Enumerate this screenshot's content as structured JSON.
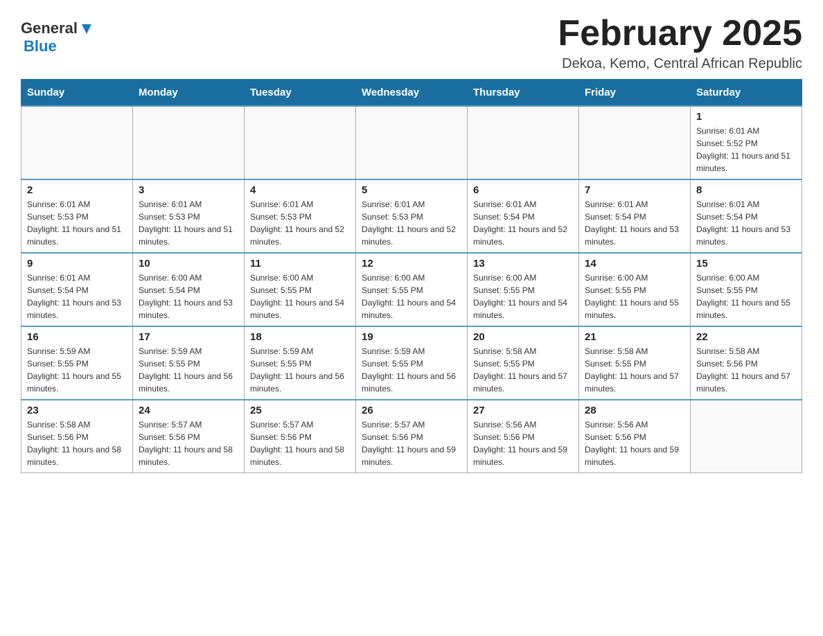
{
  "header": {
    "logo": {
      "general": "General",
      "blue": "Blue"
    },
    "title": "February 2025",
    "subtitle": "Dekoa, Kemo, Central African Republic"
  },
  "calendar": {
    "days_of_week": [
      "Sunday",
      "Monday",
      "Tuesday",
      "Wednesday",
      "Thursday",
      "Friday",
      "Saturday"
    ],
    "weeks": [
      [
        {
          "day": "",
          "info": ""
        },
        {
          "day": "",
          "info": ""
        },
        {
          "day": "",
          "info": ""
        },
        {
          "day": "",
          "info": ""
        },
        {
          "day": "",
          "info": ""
        },
        {
          "day": "",
          "info": ""
        },
        {
          "day": "1",
          "info": "Sunrise: 6:01 AM\nSunset: 5:52 PM\nDaylight: 11 hours and 51 minutes."
        }
      ],
      [
        {
          "day": "2",
          "info": "Sunrise: 6:01 AM\nSunset: 5:53 PM\nDaylight: 11 hours and 51 minutes."
        },
        {
          "day": "3",
          "info": "Sunrise: 6:01 AM\nSunset: 5:53 PM\nDaylight: 11 hours and 51 minutes."
        },
        {
          "day": "4",
          "info": "Sunrise: 6:01 AM\nSunset: 5:53 PM\nDaylight: 11 hours and 52 minutes."
        },
        {
          "day": "5",
          "info": "Sunrise: 6:01 AM\nSunset: 5:53 PM\nDaylight: 11 hours and 52 minutes."
        },
        {
          "day": "6",
          "info": "Sunrise: 6:01 AM\nSunset: 5:54 PM\nDaylight: 11 hours and 52 minutes."
        },
        {
          "day": "7",
          "info": "Sunrise: 6:01 AM\nSunset: 5:54 PM\nDaylight: 11 hours and 53 minutes."
        },
        {
          "day": "8",
          "info": "Sunrise: 6:01 AM\nSunset: 5:54 PM\nDaylight: 11 hours and 53 minutes."
        }
      ],
      [
        {
          "day": "9",
          "info": "Sunrise: 6:01 AM\nSunset: 5:54 PM\nDaylight: 11 hours and 53 minutes."
        },
        {
          "day": "10",
          "info": "Sunrise: 6:00 AM\nSunset: 5:54 PM\nDaylight: 11 hours and 53 minutes."
        },
        {
          "day": "11",
          "info": "Sunrise: 6:00 AM\nSunset: 5:55 PM\nDaylight: 11 hours and 54 minutes."
        },
        {
          "day": "12",
          "info": "Sunrise: 6:00 AM\nSunset: 5:55 PM\nDaylight: 11 hours and 54 minutes."
        },
        {
          "day": "13",
          "info": "Sunrise: 6:00 AM\nSunset: 5:55 PM\nDaylight: 11 hours and 54 minutes."
        },
        {
          "day": "14",
          "info": "Sunrise: 6:00 AM\nSunset: 5:55 PM\nDaylight: 11 hours and 55 minutes."
        },
        {
          "day": "15",
          "info": "Sunrise: 6:00 AM\nSunset: 5:55 PM\nDaylight: 11 hours and 55 minutes."
        }
      ],
      [
        {
          "day": "16",
          "info": "Sunrise: 5:59 AM\nSunset: 5:55 PM\nDaylight: 11 hours and 55 minutes."
        },
        {
          "day": "17",
          "info": "Sunrise: 5:59 AM\nSunset: 5:55 PM\nDaylight: 11 hours and 56 minutes."
        },
        {
          "day": "18",
          "info": "Sunrise: 5:59 AM\nSunset: 5:55 PM\nDaylight: 11 hours and 56 minutes."
        },
        {
          "day": "19",
          "info": "Sunrise: 5:59 AM\nSunset: 5:55 PM\nDaylight: 11 hours and 56 minutes."
        },
        {
          "day": "20",
          "info": "Sunrise: 5:58 AM\nSunset: 5:55 PM\nDaylight: 11 hours and 57 minutes."
        },
        {
          "day": "21",
          "info": "Sunrise: 5:58 AM\nSunset: 5:55 PM\nDaylight: 11 hours and 57 minutes."
        },
        {
          "day": "22",
          "info": "Sunrise: 5:58 AM\nSunset: 5:56 PM\nDaylight: 11 hours and 57 minutes."
        }
      ],
      [
        {
          "day": "23",
          "info": "Sunrise: 5:58 AM\nSunset: 5:56 PM\nDaylight: 11 hours and 58 minutes."
        },
        {
          "day": "24",
          "info": "Sunrise: 5:57 AM\nSunset: 5:56 PM\nDaylight: 11 hours and 58 minutes."
        },
        {
          "day": "25",
          "info": "Sunrise: 5:57 AM\nSunset: 5:56 PM\nDaylight: 11 hours and 58 minutes."
        },
        {
          "day": "26",
          "info": "Sunrise: 5:57 AM\nSunset: 5:56 PM\nDaylight: 11 hours and 59 minutes."
        },
        {
          "day": "27",
          "info": "Sunrise: 5:56 AM\nSunset: 5:56 PM\nDaylight: 11 hours and 59 minutes."
        },
        {
          "day": "28",
          "info": "Sunrise: 5:56 AM\nSunset: 5:56 PM\nDaylight: 11 hours and 59 minutes."
        },
        {
          "day": "",
          "info": ""
        }
      ]
    ]
  }
}
